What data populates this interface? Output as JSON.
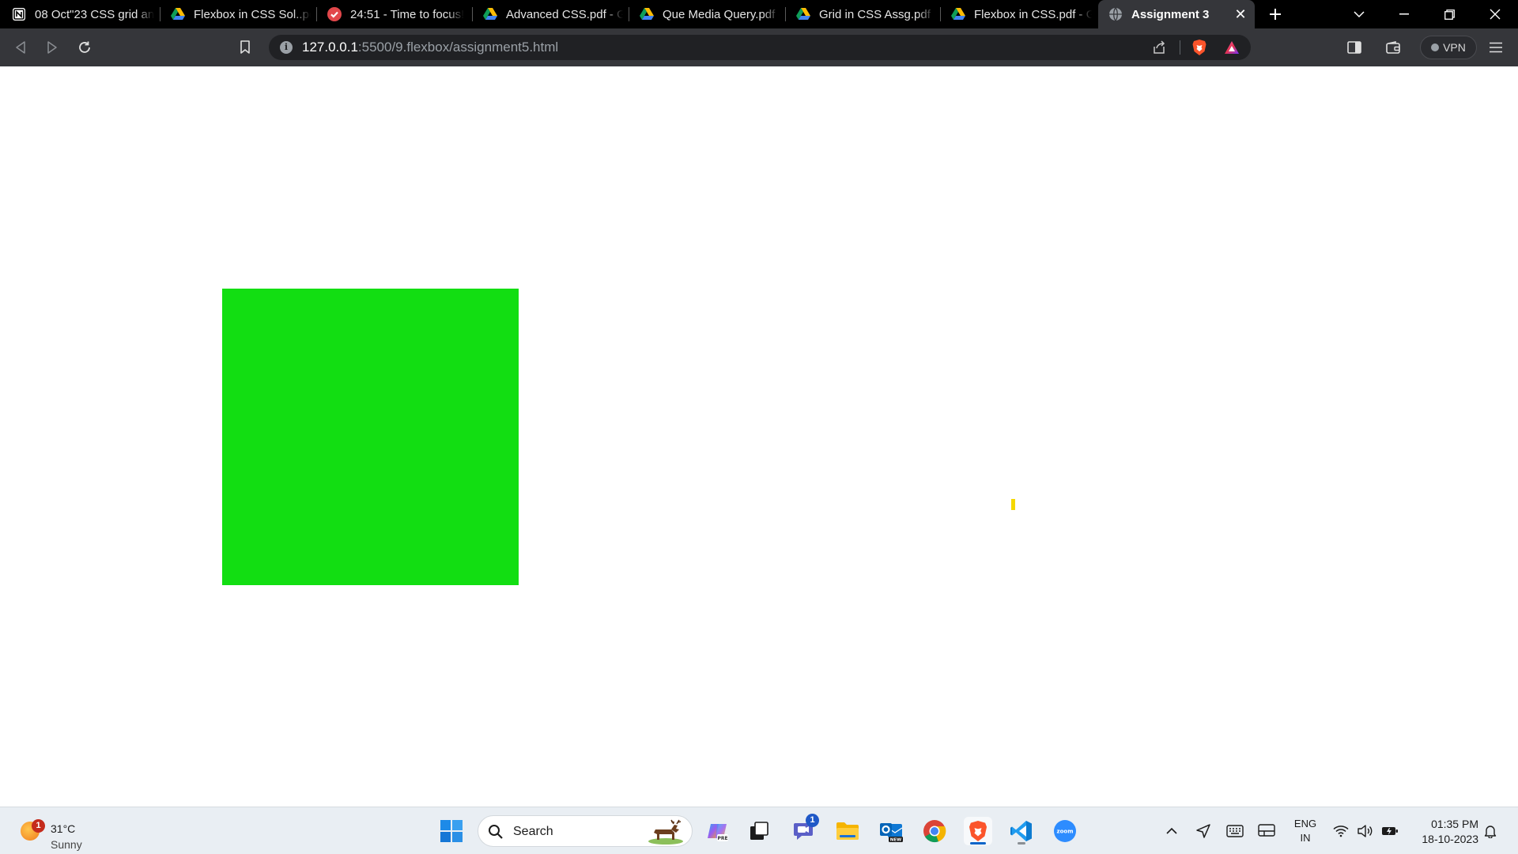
{
  "browser": {
    "tabs": [
      {
        "title": "08 Oct\"23 CSS grid and",
        "icon": "notion-icon"
      },
      {
        "title": "Flexbox in CSS Sol..pdf",
        "icon": "drive-icon"
      },
      {
        "title": "24:51 - Time to focus!",
        "icon": "timer-check-icon"
      },
      {
        "title": "Advanced CSS.pdf - Go",
        "icon": "drive-icon"
      },
      {
        "title": "Que Media Query.pdf -",
        "icon": "drive-icon"
      },
      {
        "title": "Grid in CSS Assg.pdf - G",
        "icon": "drive-icon"
      },
      {
        "title": "Flexbox in CSS.pdf - Go",
        "icon": "drive-icon"
      },
      {
        "title": "Assignment 3",
        "icon": "globe-icon",
        "active": true
      }
    ],
    "address": {
      "host": "127.0.0.1",
      "path": ":5500/9.flexbox/assignment5.html"
    },
    "vpn_label": "VPN"
  },
  "page": {
    "box_color": "#12de12",
    "mark_color": "#f5d800"
  },
  "taskbar": {
    "weather": {
      "temp": "31°C",
      "condition": "Sunny",
      "badge": "1"
    },
    "search_placeholder": "Search",
    "chat_badge": "1",
    "lang_line1": "ENG",
    "lang_line2": "IN",
    "time": "01:35 PM",
    "date": "18-10-2023"
  }
}
